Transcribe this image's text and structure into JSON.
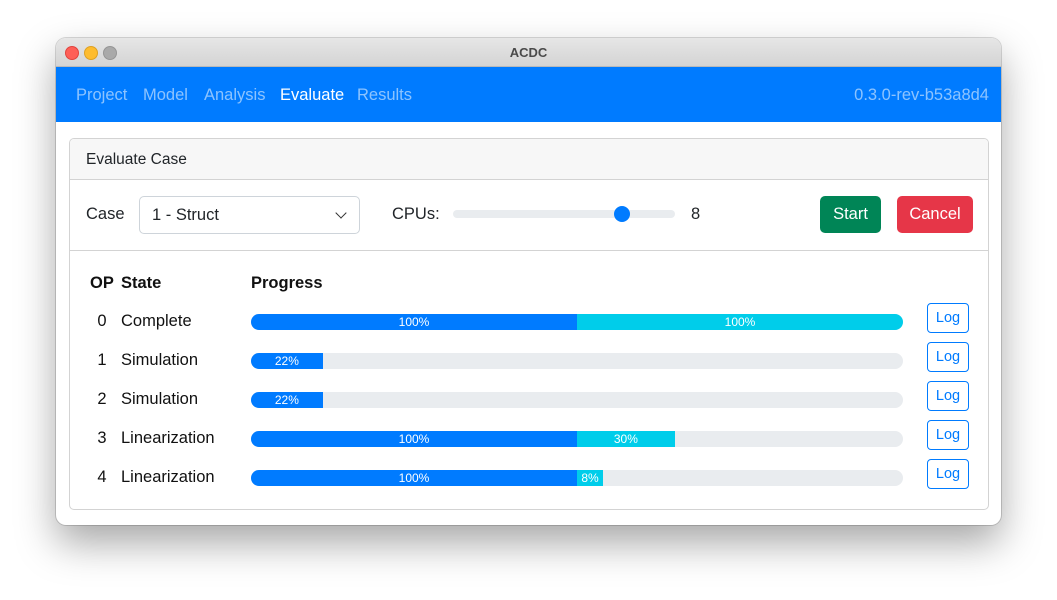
{
  "window": {
    "title": "ACDC"
  },
  "navbar": {
    "items": [
      {
        "label": "Project",
        "active": false
      },
      {
        "label": "Model",
        "active": false
      },
      {
        "label": "Analysis",
        "active": false
      },
      {
        "label": "Evaluate",
        "active": true
      },
      {
        "label": "Results",
        "active": false
      }
    ],
    "version": "0.3.0-rev-b53a8d4",
    "brand_color": "#007bff"
  },
  "card": {
    "title": "Evaluate Case",
    "case_label": "Case",
    "case_value": "1 - Struct",
    "cpus_label": "CPUs:",
    "cpus_value": "8",
    "cpus_slider_fraction": 0.76,
    "start_label": "Start",
    "cancel_label": "Cancel"
  },
  "table": {
    "headers": {
      "op": "OP",
      "state": "State",
      "progress": "Progress"
    },
    "log_label": "Log",
    "rows": [
      {
        "op": "0",
        "state": "Complete",
        "sim": 100,
        "sim_label": "100%",
        "lin": 100,
        "lin_label": "100%"
      },
      {
        "op": "1",
        "state": "Simulation",
        "sim": 22,
        "sim_label": "22%",
        "lin": 0,
        "lin_label": ""
      },
      {
        "op": "2",
        "state": "Simulation",
        "sim": 22,
        "sim_label": "22%",
        "lin": 0,
        "lin_label": ""
      },
      {
        "op": "3",
        "state": "Linearization",
        "sim": 100,
        "sim_label": "100%",
        "lin": 30,
        "lin_label": "30%"
      },
      {
        "op": "4",
        "state": "Linearization",
        "sim": 100,
        "sim_label": "100%",
        "lin": 8,
        "lin_label": "8%"
      }
    ]
  }
}
